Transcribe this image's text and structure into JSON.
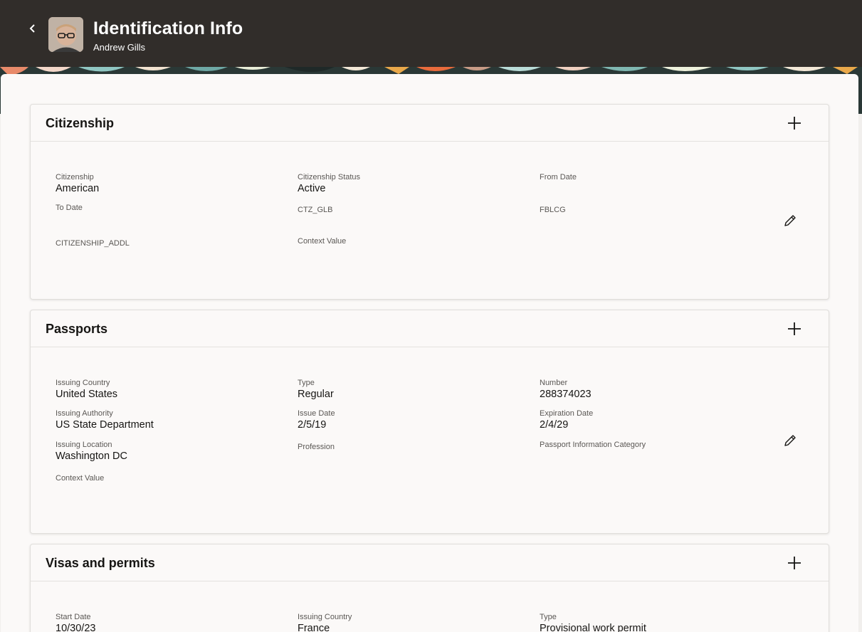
{
  "header": {
    "title": "Identification Info",
    "subtitle": "Andrew Gills",
    "colors": {
      "bar": "#312d2a",
      "text": "#ffffff"
    }
  },
  "citizenship": {
    "title": "Citizenship",
    "fields": {
      "citizenship": {
        "label": "Citizenship",
        "value": "American"
      },
      "status": {
        "label": "Citizenship Status",
        "value": "Active"
      },
      "from_date": {
        "label": "From Date",
        "value": ""
      },
      "to_date": {
        "label": "To Date",
        "value": ""
      },
      "ctz_glb": {
        "label": "CTZ_GLB",
        "value": ""
      },
      "fblcg": {
        "label": "FBLCG",
        "value": ""
      },
      "addl": {
        "label": "CITIZENSHIP_ADDL",
        "value": ""
      },
      "context": {
        "label": "Context Value",
        "value": ""
      }
    }
  },
  "passports": {
    "title": "Passports",
    "fields": {
      "issuing_country": {
        "label": "Issuing Country",
        "value": "United States"
      },
      "type": {
        "label": "Type",
        "value": "Regular"
      },
      "number": {
        "label": "Number",
        "value": "288374023"
      },
      "issuing_authority": {
        "label": "Issuing Authority",
        "value": "US State Department"
      },
      "issue_date": {
        "label": "Issue Date",
        "value": "2/5/19"
      },
      "expiration_date": {
        "label": "Expiration Date",
        "value": "2/4/29"
      },
      "issuing_location": {
        "label": "Issuing Location",
        "value": "Washington DC"
      },
      "profession": {
        "label": "Profession",
        "value": ""
      },
      "info_category": {
        "label": "Passport Information Category",
        "value": ""
      },
      "context": {
        "label": "Context Value",
        "value": ""
      }
    }
  },
  "visas": {
    "title": "Visas and permits",
    "fields": {
      "start_date": {
        "label": "Start Date",
        "value": "10/30/23"
      },
      "issuing_country": {
        "label": "Issuing Country",
        "value": "France"
      },
      "type": {
        "label": "Type",
        "value": "Provisional work permit"
      }
    }
  },
  "icons": {
    "back": "chevron-left-icon",
    "add": "plus-icon",
    "edit": "pencil-icon"
  }
}
